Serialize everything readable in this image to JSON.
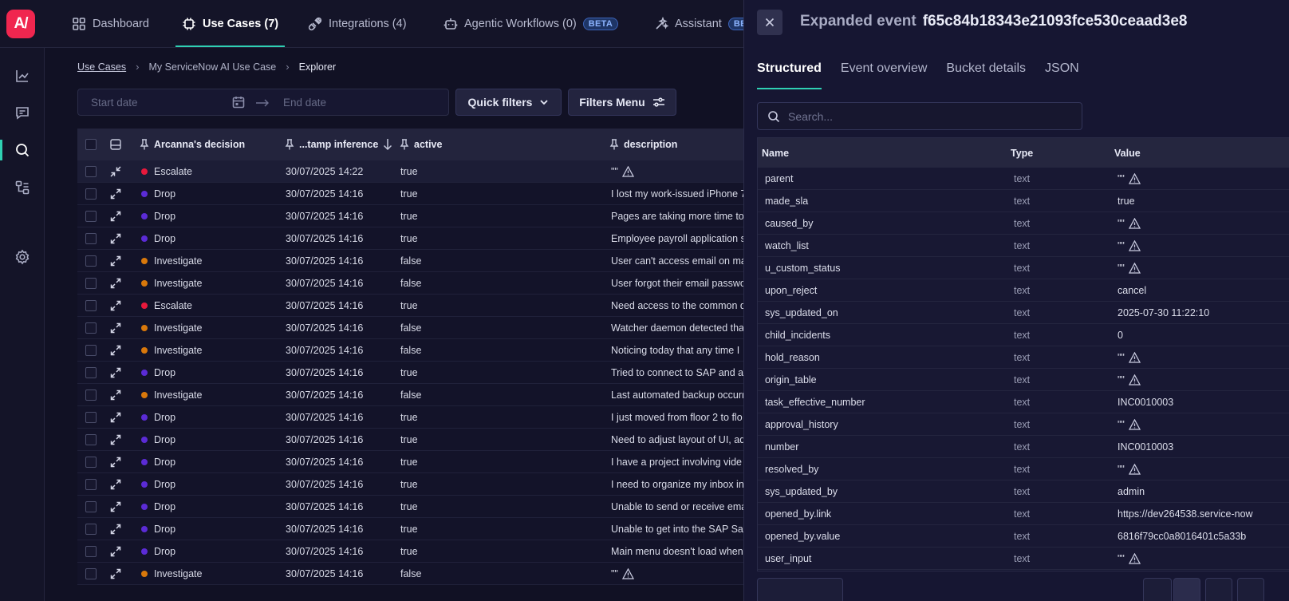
{
  "app": {
    "logo_text": "A/"
  },
  "topnav": {
    "items": [
      {
        "label": "Dashboard",
        "icon": "grid-icon"
      },
      {
        "label": "Use Cases (7)",
        "icon": "chip-icon",
        "active": true
      },
      {
        "label": "Integrations (4)",
        "icon": "plug-icon"
      },
      {
        "label": "Agentic Workflows (0)",
        "icon": "robot-icon",
        "badge": "BETA"
      },
      {
        "label": "Assistant",
        "icon": "sparkle-icon",
        "badge": "BE"
      }
    ]
  },
  "sidebar": {
    "items": [
      {
        "icon": "chart-line-icon"
      },
      {
        "icon": "chat-icon"
      },
      {
        "icon": "search-icon",
        "active": true
      },
      {
        "icon": "flow-icon"
      },
      {
        "icon": "gear-icon"
      }
    ]
  },
  "breadcrumb": {
    "items": [
      "Use Cases",
      "My ServiceNow AI Use Case",
      "Explorer"
    ]
  },
  "filters": {
    "start_placeholder": "Start date",
    "end_placeholder": "End date",
    "quick_filters": "Quick filters",
    "filters_menu": "Filters Menu"
  },
  "table": {
    "columns": [
      "Arcanna's decision",
      "...tamp inference",
      "active",
      "description"
    ],
    "rows": [
      {
        "decision": "Escalate",
        "timestamp": "30/07/2025 14:22",
        "active": "true",
        "description": "\"\"",
        "warn": true
      },
      {
        "decision": "Drop",
        "timestamp": "30/07/2025 14:16",
        "active": "true",
        "description": "I lost my work-issued iPhone 7"
      },
      {
        "decision": "Drop",
        "timestamp": "30/07/2025 14:16",
        "active": "true",
        "description": "Pages are taking more time to"
      },
      {
        "decision": "Drop",
        "timestamp": "30/07/2025 14:16",
        "active": "true",
        "description": "Employee payroll application s"
      },
      {
        "decision": "Investigate",
        "timestamp": "30/07/2025 14:16",
        "active": "false",
        "description": "User can't access email on ma"
      },
      {
        "decision": "Investigate",
        "timestamp": "30/07/2025 14:16",
        "active": "false",
        "description": "User forgot their email passwo"
      },
      {
        "decision": "Escalate",
        "timestamp": "30/07/2025 14:16",
        "active": "true",
        "description": "Need access to the common d"
      },
      {
        "decision": "Investigate",
        "timestamp": "30/07/2025 14:16",
        "active": "false",
        "description": "Watcher daemon detected tha"
      },
      {
        "decision": "Investigate",
        "timestamp": "30/07/2025 14:16",
        "active": "false",
        "description": "Noticing today that any time I"
      },
      {
        "decision": "Drop",
        "timestamp": "30/07/2025 14:16",
        "active": "true",
        "description": "Tried to connect to SAP and al"
      },
      {
        "decision": "Investigate",
        "timestamp": "30/07/2025 14:16",
        "active": "false",
        "description": "Last automated backup occurr"
      },
      {
        "decision": "Drop",
        "timestamp": "30/07/2025 14:16",
        "active": "true",
        "description": "I just moved from floor 2 to flo"
      },
      {
        "decision": "Drop",
        "timestamp": "30/07/2025 14:16",
        "active": "true",
        "description": "Need to adjust layout of UI, ad"
      },
      {
        "decision": "Drop",
        "timestamp": "30/07/2025 14:16",
        "active": "true",
        "description": "I have a project involving vide"
      },
      {
        "decision": "Drop",
        "timestamp": "30/07/2025 14:16",
        "active": "true",
        "description": "I need to organize my inbox in"
      },
      {
        "decision": "Drop",
        "timestamp": "30/07/2025 14:16",
        "active": "true",
        "description": "Unable to send or receive ema"
      },
      {
        "decision": "Drop",
        "timestamp": "30/07/2025 14:16",
        "active": "true",
        "description": "Unable to get into the SAP Sal"
      },
      {
        "decision": "Drop",
        "timestamp": "30/07/2025 14:16",
        "active": "true",
        "description": "Main menu doesn't load when"
      },
      {
        "decision": "Investigate",
        "timestamp": "30/07/2025 14:16",
        "active": "false",
        "description": "\"\"",
        "warn": true
      }
    ]
  },
  "decision_colors": {
    "Escalate": "#e8193c",
    "Drop": "#5b2bd6",
    "Investigate": "#d9780b"
  },
  "panel": {
    "title_label": "Expanded event",
    "event_id": "f65c84b18343e21093fce530ceaad3e8",
    "tabs": [
      "Structured",
      "Event overview",
      "Bucket details",
      "JSON"
    ],
    "search_placeholder": "Search...",
    "columns": [
      "Name",
      "Type",
      "Value"
    ],
    "rows": [
      {
        "name": "parent",
        "type": "text",
        "value": "\"\"",
        "warn": true
      },
      {
        "name": "made_sla",
        "type": "text",
        "value": "true"
      },
      {
        "name": "caused_by",
        "type": "text",
        "value": "\"\"",
        "warn": true
      },
      {
        "name": "watch_list",
        "type": "text",
        "value": "\"\"",
        "warn": true
      },
      {
        "name": "u_custom_status",
        "type": "text",
        "value": "\"\"",
        "warn": true
      },
      {
        "name": "upon_reject",
        "type": "text",
        "value": "cancel"
      },
      {
        "name": "sys_updated_on",
        "type": "text",
        "value": "2025-07-30 11:22:10"
      },
      {
        "name": "child_incidents",
        "type": "text",
        "value": "0"
      },
      {
        "name": "hold_reason",
        "type": "text",
        "value": "\"\"",
        "warn": true
      },
      {
        "name": "origin_table",
        "type": "text",
        "value": "\"\"",
        "warn": true
      },
      {
        "name": "task_effective_number",
        "type": "text",
        "value": "INC0010003"
      },
      {
        "name": "approval_history",
        "type": "text",
        "value": "\"\"",
        "warn": true
      },
      {
        "name": "number",
        "type": "text",
        "value": "INC0010003"
      },
      {
        "name": "resolved_by",
        "type": "text",
        "value": "\"\"",
        "warn": true
      },
      {
        "name": "sys_updated_by",
        "type": "text",
        "value": "admin"
      },
      {
        "name": "opened_by.link",
        "type": "text",
        "value": "https://dev264538.service-now"
      },
      {
        "name": "opened_by.value",
        "type": "text",
        "value": "6816f79cc0a8016401c5a33b"
      },
      {
        "name": "user_input",
        "type": "text",
        "value": "\"\"",
        "warn": true
      }
    ]
  }
}
